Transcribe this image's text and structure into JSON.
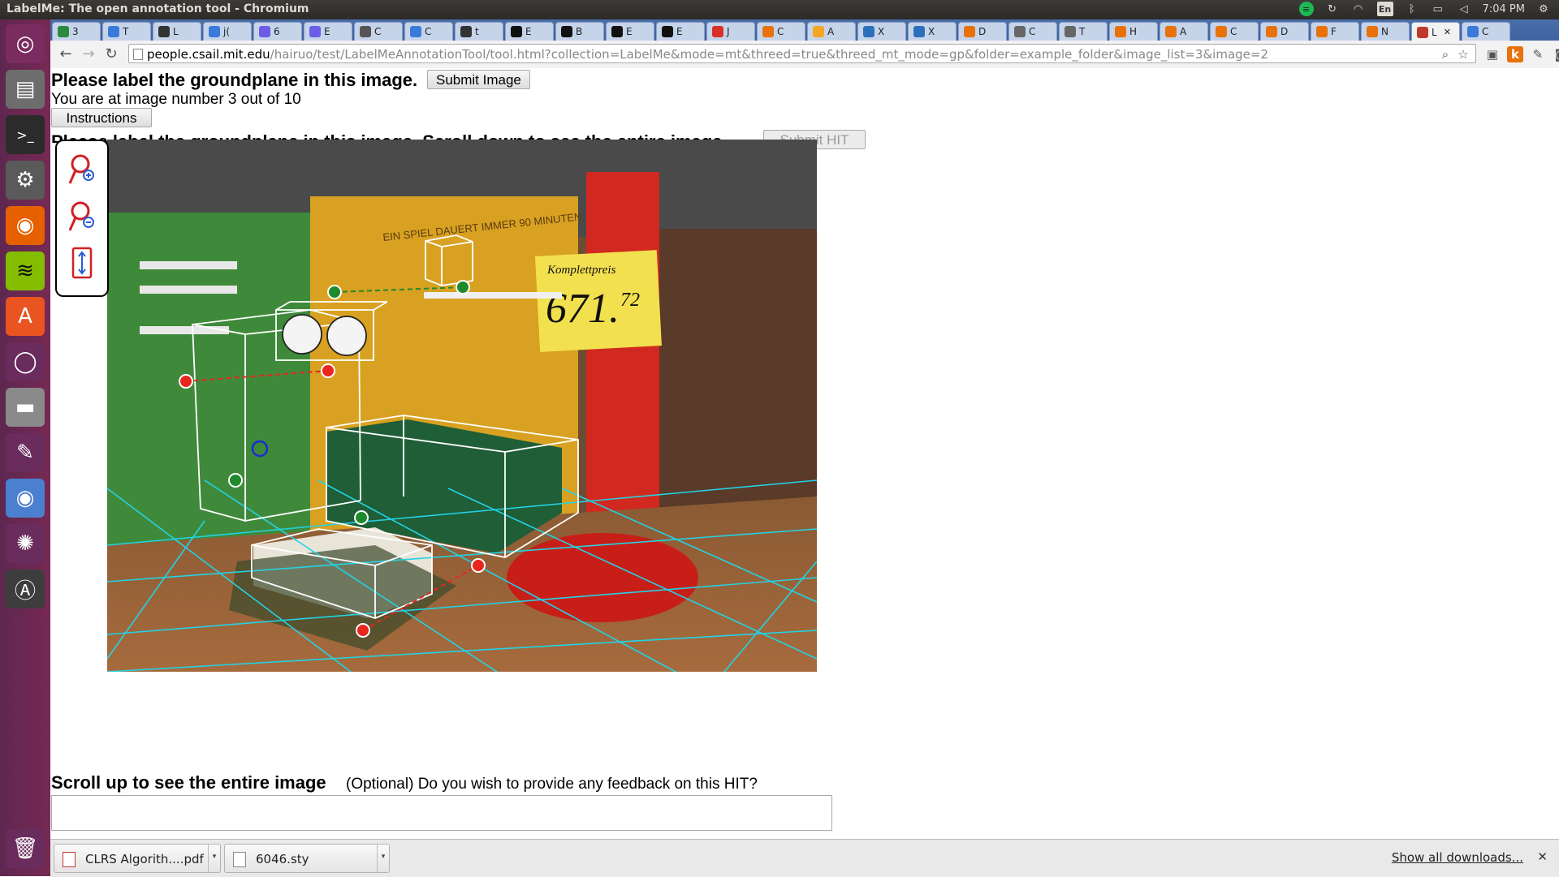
{
  "window": {
    "title": "LabelMe: The open annotation tool - Chromium"
  },
  "panel": {
    "lang": "En",
    "time": "7:04 PM"
  },
  "tabs": [
    {
      "letter": "3",
      "color": "#2b8a3e"
    },
    {
      "letter": "T",
      "color": "#3b7ad9"
    },
    {
      "letter": "L",
      "color": "#333333"
    },
    {
      "letter": "j(",
      "color": "#3b7ad9"
    },
    {
      "letter": "6",
      "color": "#6c5ce7"
    },
    {
      "letter": "E",
      "color": "#6c5ce7"
    },
    {
      "letter": "C",
      "color": "#555555"
    },
    {
      "letter": "C",
      "color": "#3b7ad9"
    },
    {
      "letter": "t",
      "color": "#333333"
    },
    {
      "letter": "E",
      "color": "#111111"
    },
    {
      "letter": "B",
      "color": "#111111"
    },
    {
      "letter": "E",
      "color": "#111111"
    },
    {
      "letter": "E",
      "color": "#111111"
    },
    {
      "letter": "J",
      "color": "#d93025"
    },
    {
      "letter": "C",
      "color": "#e8710a"
    },
    {
      "letter": "A",
      "color": "#f5a623"
    },
    {
      "letter": "X",
      "color": "#2c6fbb"
    },
    {
      "letter": "X",
      "color": "#2c6fbb"
    },
    {
      "letter": "D",
      "color": "#e8710a"
    },
    {
      "letter": "C",
      "color": "#666666"
    },
    {
      "letter": "T",
      "color": "#666666"
    },
    {
      "letter": "H",
      "color": "#e8710a"
    },
    {
      "letter": "A",
      "color": "#e8710a"
    },
    {
      "letter": "C",
      "color": "#e8710a"
    },
    {
      "letter": "D",
      "color": "#e8710a"
    },
    {
      "letter": "F",
      "color": "#e8710a"
    },
    {
      "letter": "N",
      "color": "#e8710a"
    },
    {
      "letter": "L",
      "color": "#c0392b",
      "active": true
    },
    {
      "letter": "C",
      "color": "#3b7ad9"
    }
  ],
  "address": {
    "host": "people.csail.mit.edu",
    "path": "/hairuo/test/LabelMeAnnotationTool/tool.html?collection=LabelMe&mode=mt&threed=true&threed_mt_mode=gp&folder=example_folder&image_list=3&image=2"
  },
  "page": {
    "heading": "Please label the groundplane in this image.",
    "submit_image": "Submit Image",
    "counter": "You are at image number 3 out of 10",
    "instructions": "Instructions",
    "second_heading": "Please label the groundplane in this image. Scroll down to see the entire image.",
    "submit_hit": "Submit HIT",
    "scene": {
      "sign_label": "Komplettpreis",
      "price": "671.",
      "price_cents": "72",
      "wall_text": "EIN SPIEL DAUERT IMMER 90 MINUTEN."
    },
    "bottom_text": "Scroll up to see the entire image",
    "feedback_question": "(Optional) Do you wish to provide any feedback on this HIT?",
    "feedback_value": ""
  },
  "downloads": {
    "items": [
      {
        "name": "CLRS Algorith....pdf"
      },
      {
        "name": "6046.sty"
      }
    ],
    "show_all": "Show all downloads..."
  }
}
